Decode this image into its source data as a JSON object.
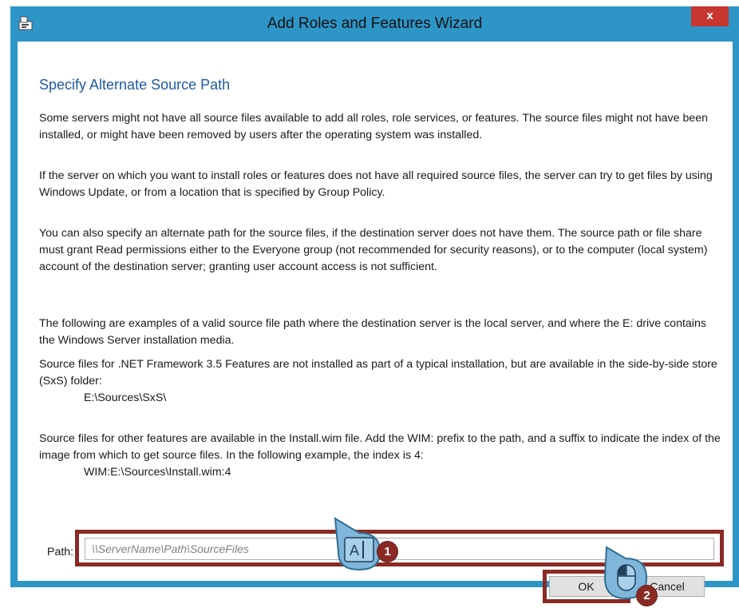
{
  "window": {
    "title": "Add Roles and Features Wizard",
    "close_label": "x"
  },
  "dialog": {
    "heading": "Specify Alternate Source Path",
    "para1": "Some servers might not have all source files available to add all roles, role services, or features. The source files might not have been installed, or might have been removed by users after the operating system was installed.",
    "para2": "If the server on which you want to install roles or features does not have all required source files, the server can try to get files by using Windows Update, or from a location that is specified by Group Policy.",
    "para3": "You can also specify an alternate path for the source files, if the destination server does not have them. The source path or file share must grant Read permissions either to the Everyone group (not recommended for security reasons), or to the computer (local system) account of the destination server; granting user account access is not sufficient.",
    "para4": "The following are examples of a valid source file path where the destination server is the local server, and where the E: drive contains the Windows Server installation media.",
    "para5": "Source files for .NET Framework 3.5 Features are not installed as part of a typical installation, but are available in the side-by-side store (SxS) folder:",
    "example1": "E:\\Sources\\SxS\\",
    "para6": "Source files for other features are available in the Install.wim file. Add the WIM: prefix to the path, and a suffix to indicate the index of the image from which to get source files. In the following example, the index is 4:",
    "example2": "WIM:E:\\Sources\\Install.wim:4",
    "path_label": "Path:",
    "path_placeholder": "\\\\ServerName\\Path\\SourceFiles",
    "path_value": "",
    "ok_label": "OK",
    "cancel_label": "Cancel"
  },
  "annotations": {
    "step1": "1",
    "step2": "2",
    "text_cursor_glyph": "A|",
    "accent": "#8b2a25",
    "callout_color": "#7fb6d9"
  }
}
